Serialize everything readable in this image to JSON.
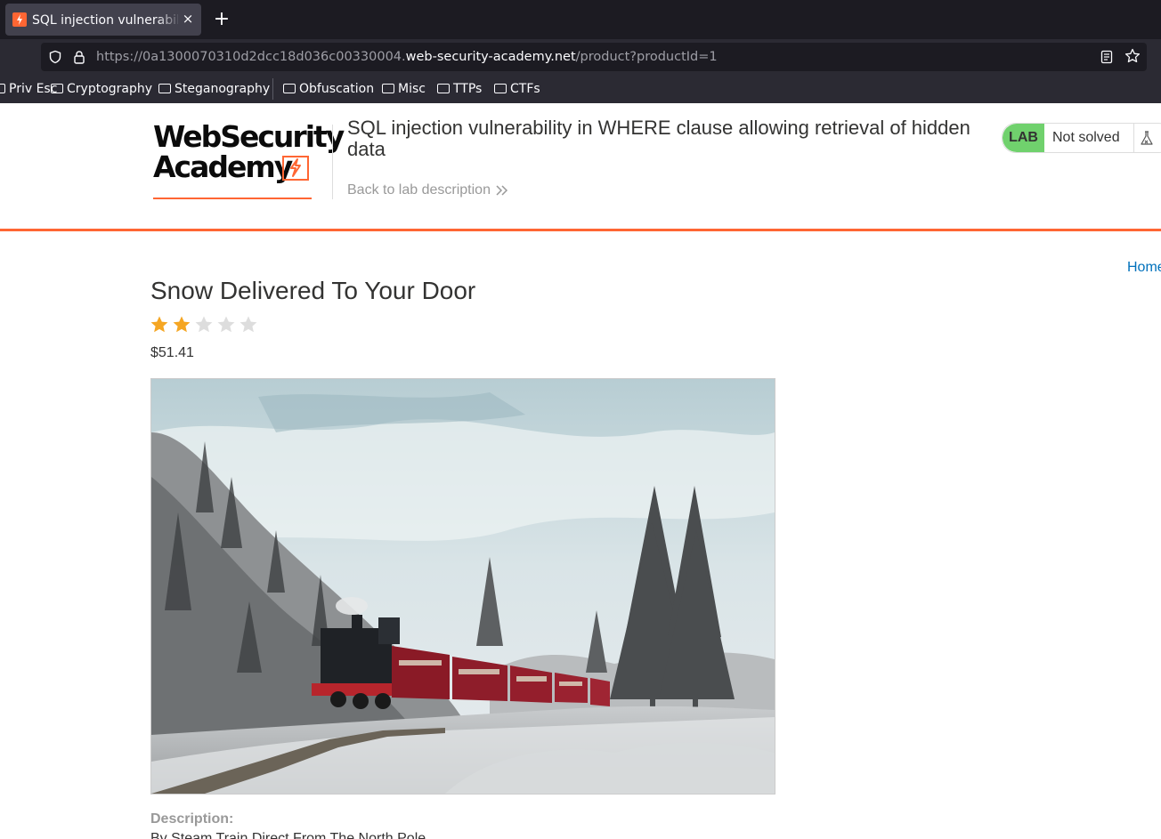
{
  "browser": {
    "tab": {
      "title": "SQL injection vulnerability in WHERE clause allowing retrieval of hidden data",
      "close_label": "×"
    },
    "new_tab_label": "+",
    "url": {
      "prefix": "https://0a1300070310d2dcc18d036c00330004.",
      "host": "web-security-academy.net",
      "path": "/product?productId=1"
    },
    "bookmarks": [
      {
        "label": "Priv Esc"
      },
      {
        "label": "Cryptography"
      },
      {
        "label": "Steganography"
      },
      {
        "label": "Obfuscation"
      },
      {
        "label": "Misc"
      },
      {
        "label": "TTPs"
      },
      {
        "label": "CTFs"
      }
    ]
  },
  "header": {
    "logo": {
      "line1": "WebSecurity",
      "line2": "Academy"
    },
    "lab_title": "SQL injection vulnerability in WHERE clause allowing retrieval of hidden data",
    "back_link": "Back to lab description",
    "status": {
      "badge": "LAB",
      "text": "Not solved"
    }
  },
  "nav": {
    "home": "Home"
  },
  "product": {
    "title": "Snow Delivered To Your Door",
    "rating": 2,
    "rating_max": 5,
    "price": "$51.41",
    "description_label": "Description:",
    "description": "By Steam Train Direct From The North Pole"
  },
  "colors": {
    "accent": "#ff6633",
    "lab_badge": "#70d16d",
    "link": "#0071bc",
    "star_filled": "#f5a623",
    "star_empty": "#dddddd"
  }
}
